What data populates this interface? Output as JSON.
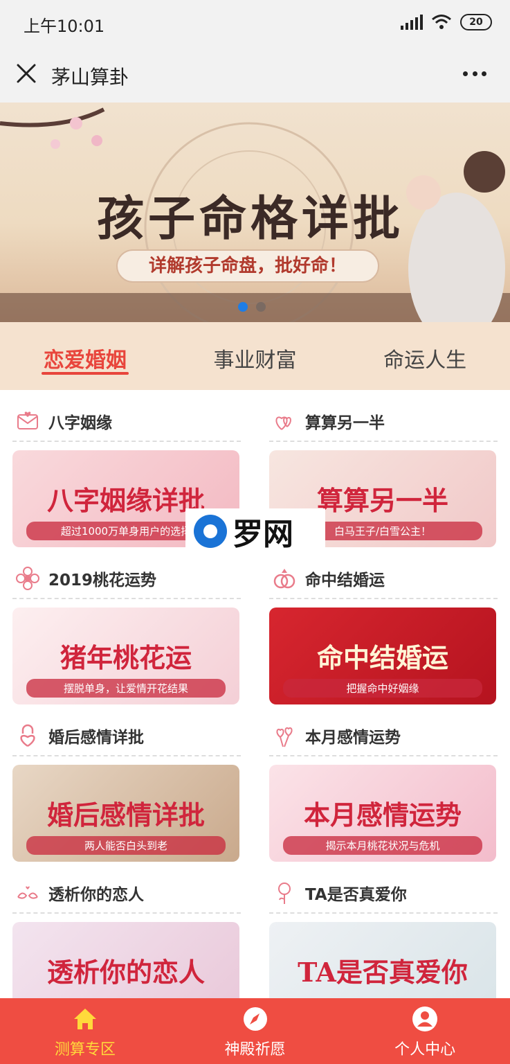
{
  "status_bar": {
    "time": "上午10:01",
    "battery": "20"
  },
  "nav": {
    "title": "茅山算卦"
  },
  "banner": {
    "title": "孩子命格详批",
    "subtitle": "详解孩子命盘，批好命！"
  },
  "tabs": [
    {
      "label": "恋爱婚姻",
      "active": true
    },
    {
      "label": "事业财富",
      "active": false
    },
    {
      "label": "命运人生",
      "active": false
    }
  ],
  "cards": [
    {
      "title": "八字姻缘",
      "banner_text": "八字姻缘详批",
      "banner_sub": "超过1000万单身用户的选择",
      "icon": "envelope-heart-icon",
      "colors": [
        "#f9d9dc",
        "#f3b9c2"
      ]
    },
    {
      "title": "算算另一半",
      "banner_text": "算算另一半",
      "banner_sub": "白马王子/白雪公主！",
      "icon": "hearts-icon",
      "colors": [
        "#f7e6e0",
        "#f1c8c8"
      ]
    },
    {
      "title": "2019桃花运势",
      "banner_text": "猪年桃花运",
      "banner_sub": "摆脱单身，让爱情开花结果",
      "icon": "flower-icon",
      "colors": [
        "#fdeff0",
        "#f4cfd6"
      ]
    },
    {
      "title": "命中结婚运",
      "banner_text": "命中结婚运",
      "banner_sub": "把握命中好姻缘",
      "icon": "rings-icon",
      "colors": [
        "#d7262f",
        "#b5131f"
      ]
    },
    {
      "title": "婚后感情详批",
      "banner_text": "婚后感情详批",
      "banner_sub": "两人能否白头到老",
      "icon": "lock-heart-icon",
      "colors": [
        "#e8d7c5",
        "#c9a98c"
      ]
    },
    {
      "title": "本月感情运势",
      "banner_text": "本月感情运势",
      "banner_sub": "揭示本月桃花状况与危机",
      "icon": "heart-balloon-icon",
      "colors": [
        "#fbe3e8",
        "#f3bccb"
      ]
    },
    {
      "title": "透析你的恋人",
      "banner_text": "透析你的恋人",
      "banner_sub": "",
      "icon": "birds-icon",
      "colors": [
        "#f3e4ef",
        "#e9c8d9"
      ]
    },
    {
      "title": "TA是否真爱你",
      "banner_text": "TA是否真爱你",
      "banner_sub": "",
      "icon": "rose-icon",
      "colors": [
        "#eef1f4",
        "#d9e4e8"
      ]
    }
  ],
  "watermark": {
    "text": "罗网"
  },
  "tabbar": [
    {
      "label": "测算专区",
      "icon": "home-icon",
      "active": true
    },
    {
      "label": "神殿祈愿",
      "icon": "compass-icon",
      "active": false
    },
    {
      "label": "个人中心",
      "icon": "user-icon",
      "active": false
    }
  ]
}
